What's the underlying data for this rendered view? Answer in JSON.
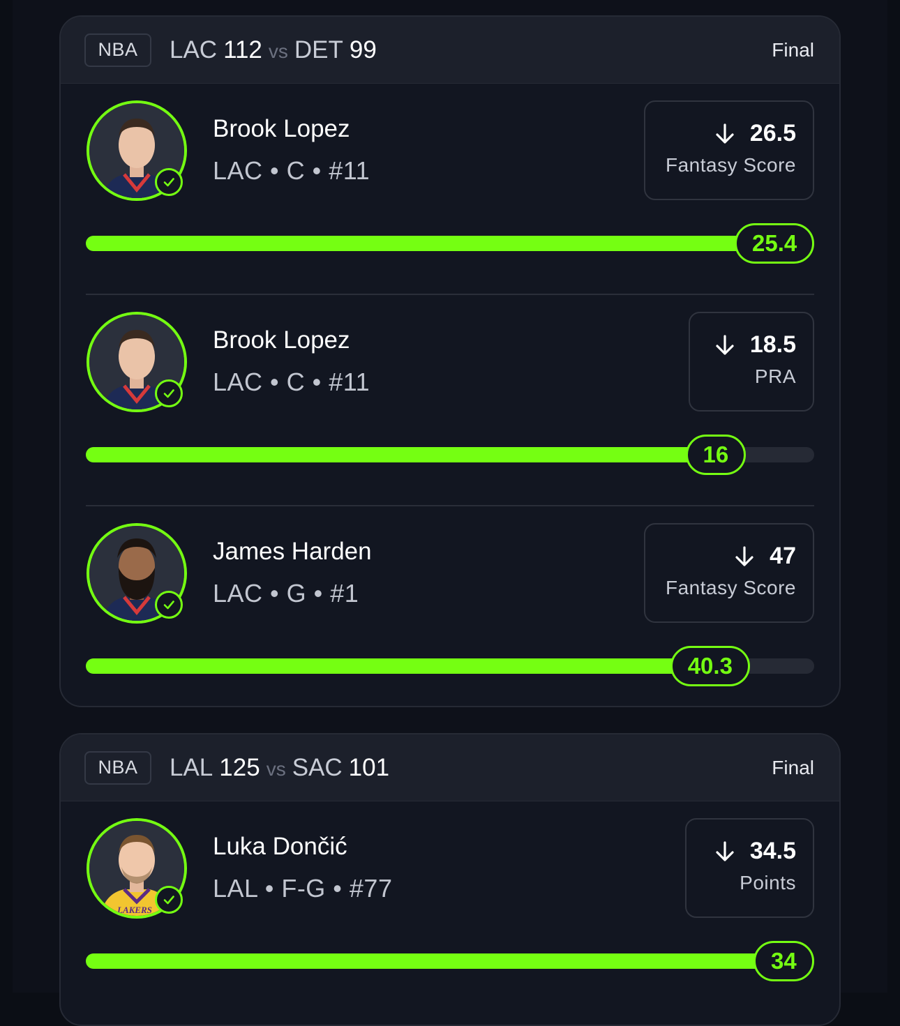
{
  "colors": {
    "accent": "#75ff12",
    "card": "#121621",
    "header": "#1c202b",
    "background": "#0e111a"
  },
  "games": [
    {
      "league": "NBA",
      "home_team": "LAC",
      "home_score": "112",
      "vs": "vs",
      "away_team": "DET",
      "away_score": "99",
      "status": "Final",
      "picks": [
        {
          "name": "Brook Lopez",
          "meta": "LAC • C • #11",
          "line": "26.5",
          "stat": "Fantasy Score",
          "direction": "arrow-down-icon",
          "actual": "25.4",
          "progress": 1.0,
          "avatar": "lopez"
        },
        {
          "name": "Brook Lopez",
          "meta": "LAC • C • #11",
          "line": "18.5",
          "stat": "PRA",
          "direction": "arrow-down-icon",
          "actual": "16",
          "progress": 0.865,
          "avatar": "lopez"
        },
        {
          "name": "James Harden",
          "meta": "LAC • G • #1",
          "line": "47",
          "stat": "Fantasy Score",
          "direction": "arrow-down-icon",
          "actual": "40.3",
          "progress": 0.857,
          "avatar": "harden"
        }
      ]
    },
    {
      "league": "NBA",
      "home_team": "LAL",
      "home_score": "125",
      "vs": "vs",
      "away_team": "SAC",
      "away_score": "101",
      "status": "Final",
      "picks": [
        {
          "name": "Luka Dončić",
          "meta": "LAL • F-G • #77",
          "line": "34.5",
          "stat": "Points",
          "direction": "arrow-down-icon",
          "actual": "34",
          "progress": 0.986,
          "avatar": "doncic",
          "jersey_text": "LAKERS"
        }
      ]
    }
  ]
}
